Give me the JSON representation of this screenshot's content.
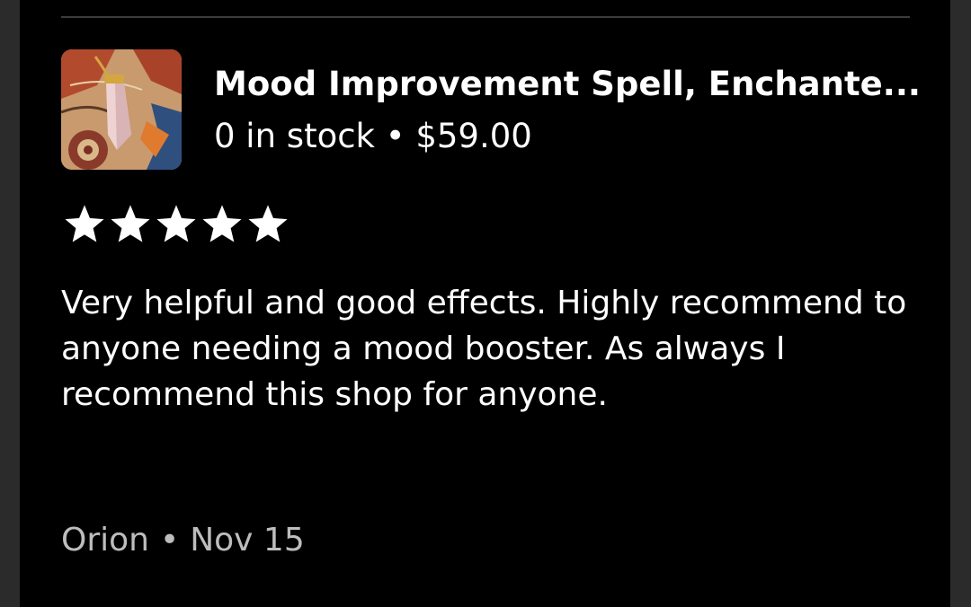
{
  "listing": {
    "title": "Mood Improvement Spell, Enchante...",
    "stock": "0 in stock",
    "separator": "•",
    "price": "$59.00",
    "thumbnail_icon": "crystal-pendant-product-image"
  },
  "review": {
    "rating": 5,
    "rating_max": 5,
    "text": "Very helpful and good effects. Highly recommend to anyone needing a mood booster. As always I recommend this shop for anyone.",
    "author": "Orion",
    "separator": "•",
    "date": "Nov 15"
  },
  "colors": {
    "background": "#000000",
    "text": "#ffffff",
    "muted": "#bdbdbd",
    "star": "#ffffff"
  }
}
